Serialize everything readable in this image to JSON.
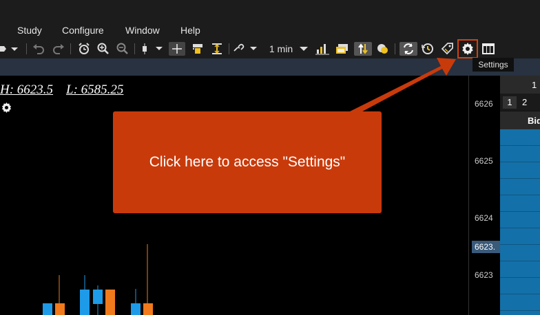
{
  "menu": {
    "items": [
      "Study",
      "Configure",
      "Window",
      "Help"
    ]
  },
  "toolbar": {
    "interval_label": "1 min",
    "icons": [
      "cursor-icon",
      "undo-icon",
      "redo-icon",
      "alarm-icon",
      "zoom-in-icon",
      "zoom-out-icon",
      "candlestick-icon",
      "crosshair-icon",
      "lock-icon",
      "fit-icon",
      "link-icon",
      "bar-chart-icon",
      "window-icon",
      "sort-icon",
      "coins-icon",
      "refresh-icon",
      "history-icon",
      "tag-icon",
      "settings-icon",
      "columns-icon"
    ]
  },
  "chart": {
    "high_label": "H: 6623.5",
    "low_label": "L: 6585.25"
  },
  "price_axis": {
    "labels": [
      "6626",
      "6625",
      "6624",
      "6623"
    ],
    "current_price": "6623."
  },
  "dom": {
    "header_value": "1",
    "page_a": "1",
    "page_b": "2",
    "column_label": "Bid"
  },
  "callout": {
    "text": "Click here to access \"Settings\""
  },
  "tooltip": {
    "text": "Settings"
  },
  "colors": {
    "accent_orange": "#c93a0b",
    "up_candle": "#1e9be8",
    "down_candle": "#f07a1c",
    "bid_blue": "#1470a8"
  }
}
